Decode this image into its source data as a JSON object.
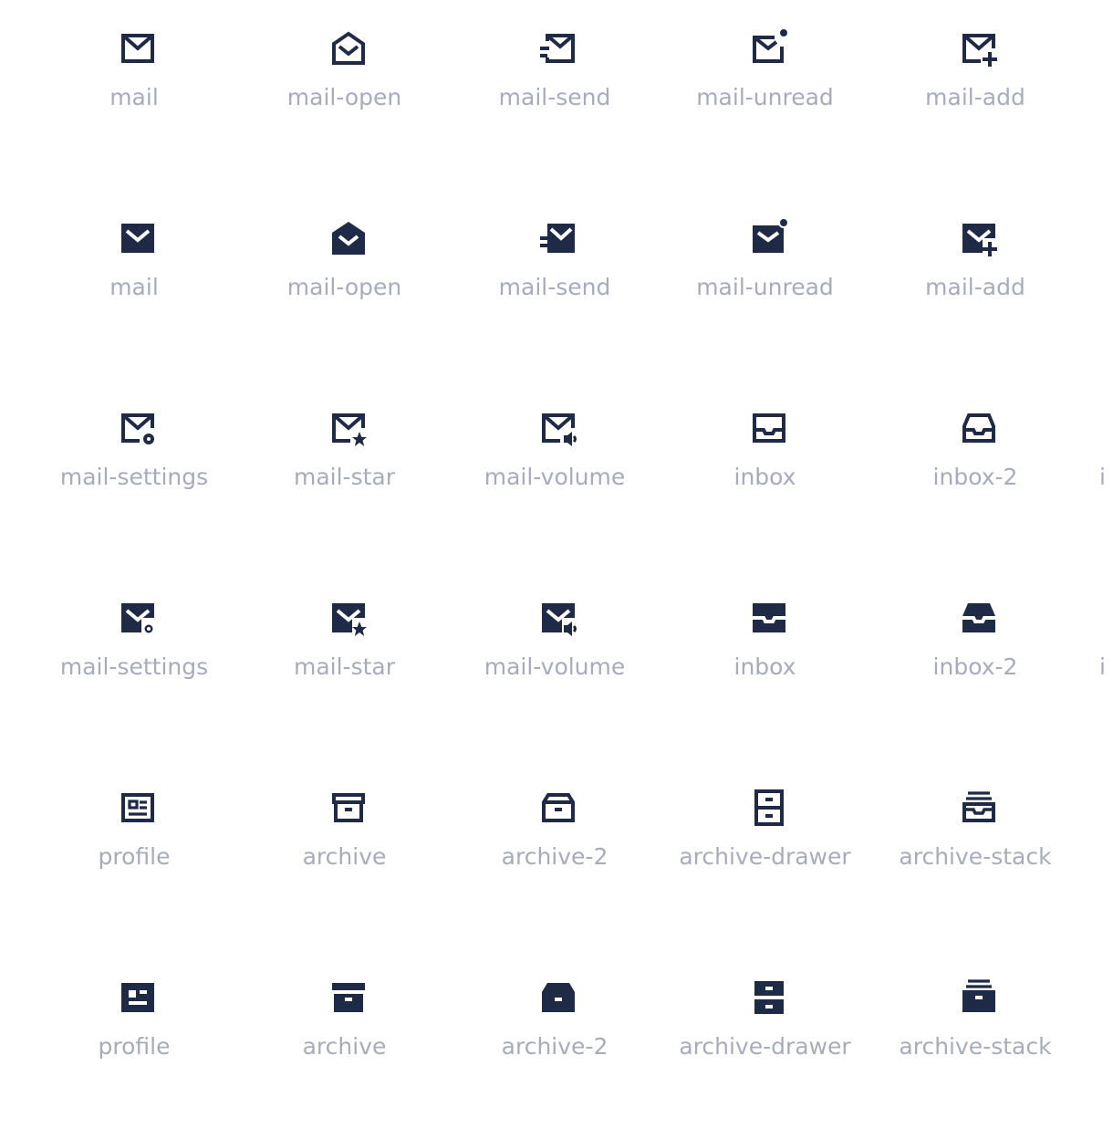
{
  "icon_color": "#1f2a47",
  "label_color": "#a7acba",
  "rows": [
    {
      "variant": "outline",
      "items": [
        "mail",
        "mail-open",
        "mail-send",
        "mail-unread",
        "mail-add"
      ]
    },
    {
      "variant": "filled",
      "items": [
        "mail",
        "mail-open",
        "mail-send",
        "mail-unread",
        "mail-add"
      ]
    },
    {
      "variant": "outline",
      "items": [
        "mail-settings",
        "mail-star",
        "mail-volume",
        "inbox",
        "inbox-2"
      ],
      "partial": "i"
    },
    {
      "variant": "filled",
      "items": [
        "mail-settings",
        "mail-star",
        "mail-volume",
        "inbox",
        "inbox-2"
      ],
      "partial": "i"
    },
    {
      "variant": "outline",
      "items": [
        "profile",
        "archive",
        "archive-2",
        "archive-drawer",
        "archive-stack"
      ]
    },
    {
      "variant": "filled",
      "items": [
        "profile",
        "archive",
        "archive-2",
        "archive-drawer",
        "archive-stack"
      ]
    }
  ]
}
